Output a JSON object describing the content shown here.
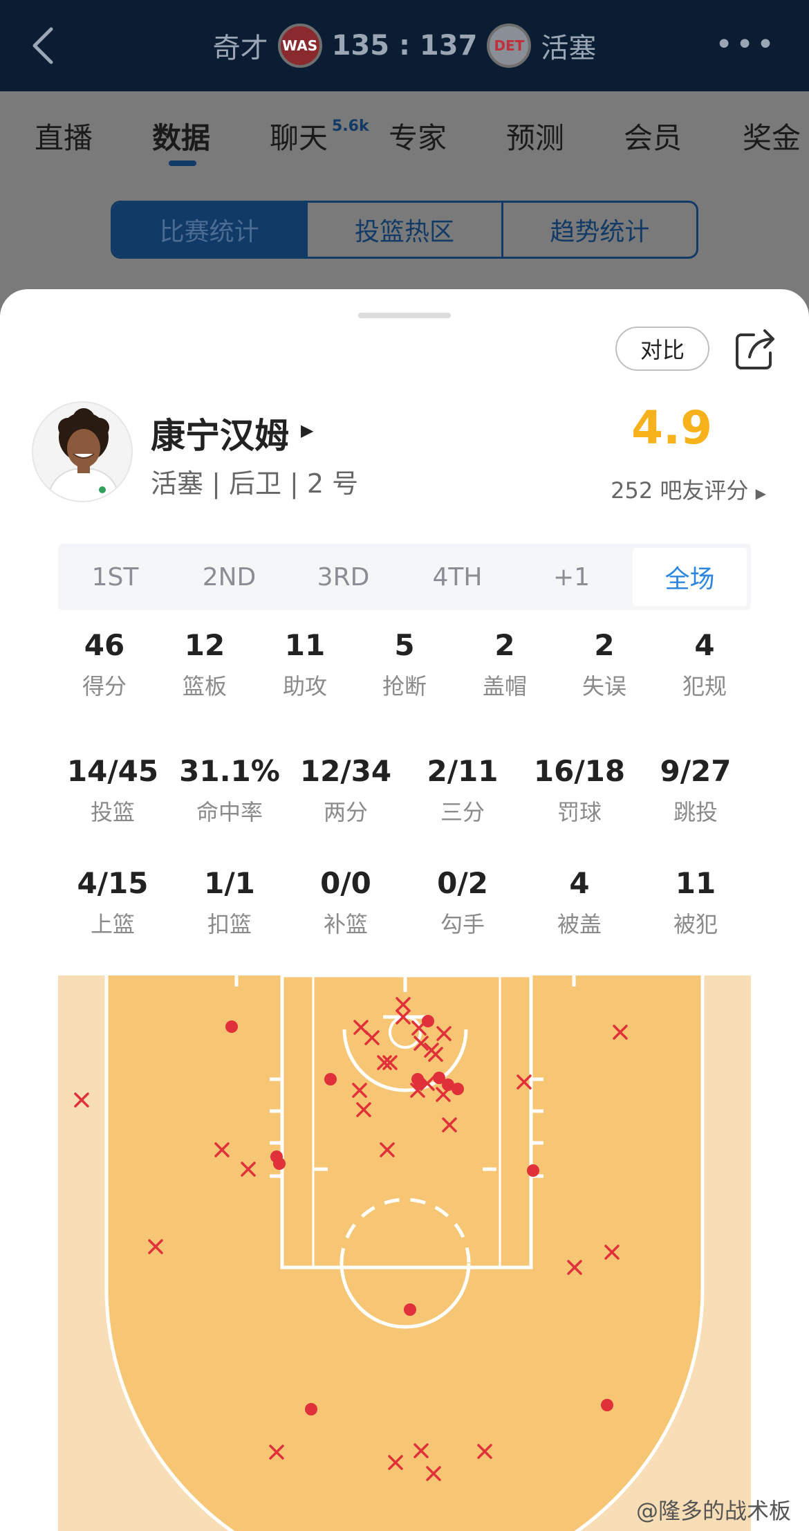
{
  "header": {
    "home_team": "奇才",
    "home_logo": "WAS",
    "score": "135 : 137",
    "away_logo": "DET",
    "away_team": "活塞"
  },
  "tabs": [
    {
      "label": "直播"
    },
    {
      "label": "数据"
    },
    {
      "label": "聊天"
    },
    {
      "label": "专家"
    },
    {
      "label": "预测"
    },
    {
      "label": "会员"
    },
    {
      "label": "奖金"
    }
  ],
  "chat_badge": "5.6k",
  "segments": [
    "比赛统计",
    "投篮热区",
    "趋势统计"
  ],
  "compare_label": "对比",
  "player": {
    "name": "康宁汉姆",
    "info": "活塞 | 后卫 | 2 号",
    "rating": "4.9",
    "rating_count": "252 吧友评分"
  },
  "periods": [
    "1ST",
    "2ND",
    "3RD",
    "4TH",
    "+1",
    "全场"
  ],
  "stats_row1": [
    {
      "value": "46",
      "label": "得分"
    },
    {
      "value": "12",
      "label": "篮板"
    },
    {
      "value": "11",
      "label": "助攻"
    },
    {
      "value": "5",
      "label": "抢断"
    },
    {
      "value": "2",
      "label": "盖帽"
    },
    {
      "value": "2",
      "label": "失误"
    },
    {
      "value": "4",
      "label": "犯规"
    }
  ],
  "stats_row2": [
    {
      "value": "14/45",
      "label": "投篮"
    },
    {
      "value": "31.1%",
      "label": "命中率"
    },
    {
      "value": "12/34",
      "label": "两分"
    },
    {
      "value": "2/11",
      "label": "三分"
    },
    {
      "value": "16/18",
      "label": "罚球"
    },
    {
      "value": "9/27",
      "label": "跳投"
    }
  ],
  "stats_row3": [
    {
      "value": "4/15",
      "label": "上篮"
    },
    {
      "value": "1/1",
      "label": "扣篮"
    },
    {
      "value": "0/0",
      "label": "补篮"
    },
    {
      "value": "0/2",
      "label": "勾手"
    },
    {
      "value": "4",
      "label": "被盖"
    },
    {
      "value": "11",
      "label": "被犯"
    }
  ],
  "shot_chart": {
    "made_color": "#e0303a",
    "missed_color": "#e0303a",
    "made_count": 14,
    "missed_count": 31
  },
  "watermark": "@隆多的战术板"
}
